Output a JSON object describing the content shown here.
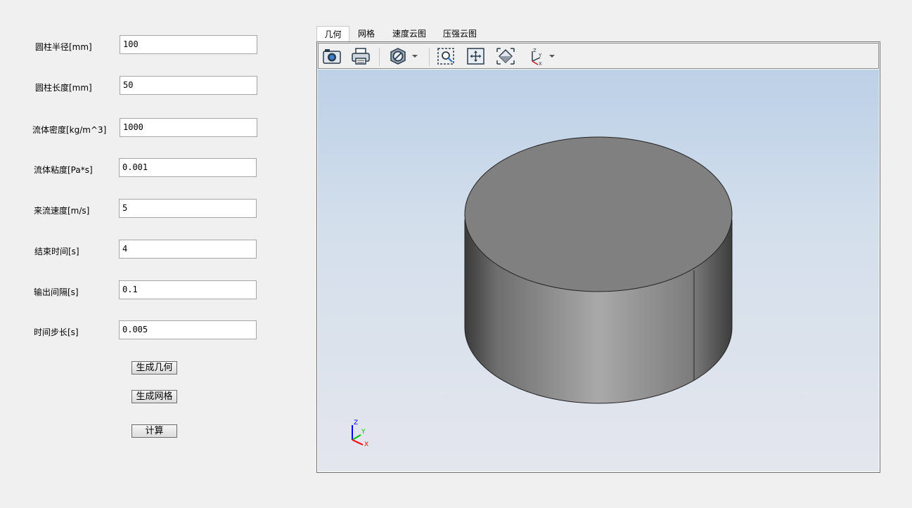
{
  "form": {
    "fields": [
      {
        "label": "圆柱半径[mm]",
        "value": "100"
      },
      {
        "label": "圆柱长度[mm]",
        "value": "50"
      },
      {
        "label": "流体密度[kg/m^3]",
        "value": "1000"
      },
      {
        "label": "流体粘度[Pa*s]",
        "value": "0.001"
      },
      {
        "label": "来流速度[m/s]",
        "value": "5"
      },
      {
        "label": "结束时间[s]",
        "value": "4"
      },
      {
        "label": "输出间隔[s]",
        "value": "0.1"
      },
      {
        "label": "时间步长[s]",
        "value": "0.005"
      }
    ],
    "buttons": {
      "generate_geometry": "生成几何",
      "generate_mesh": "生成网格",
      "compute": "计算"
    }
  },
  "viewer": {
    "tabs": [
      "几何",
      "网格",
      "速度云图",
      "压强云图"
    ],
    "active_tab": "几何",
    "toolbar": {
      "icons": [
        "camera-icon",
        "print-icon",
        "display-mode-icon",
        "zoom-window-icon",
        "pan-icon",
        "fit-all-icon",
        "view-orientation-icon"
      ]
    },
    "triad": {
      "z": "Z",
      "y": "Y",
      "x": "X"
    },
    "colors": {
      "background_top": "#bcd0e7",
      "background_bottom": "#e4e6ed",
      "cylinder_top": "#808080",
      "axis_x": "#ff0000",
      "axis_y": "#00c000",
      "axis_z": "#0000ff"
    }
  }
}
